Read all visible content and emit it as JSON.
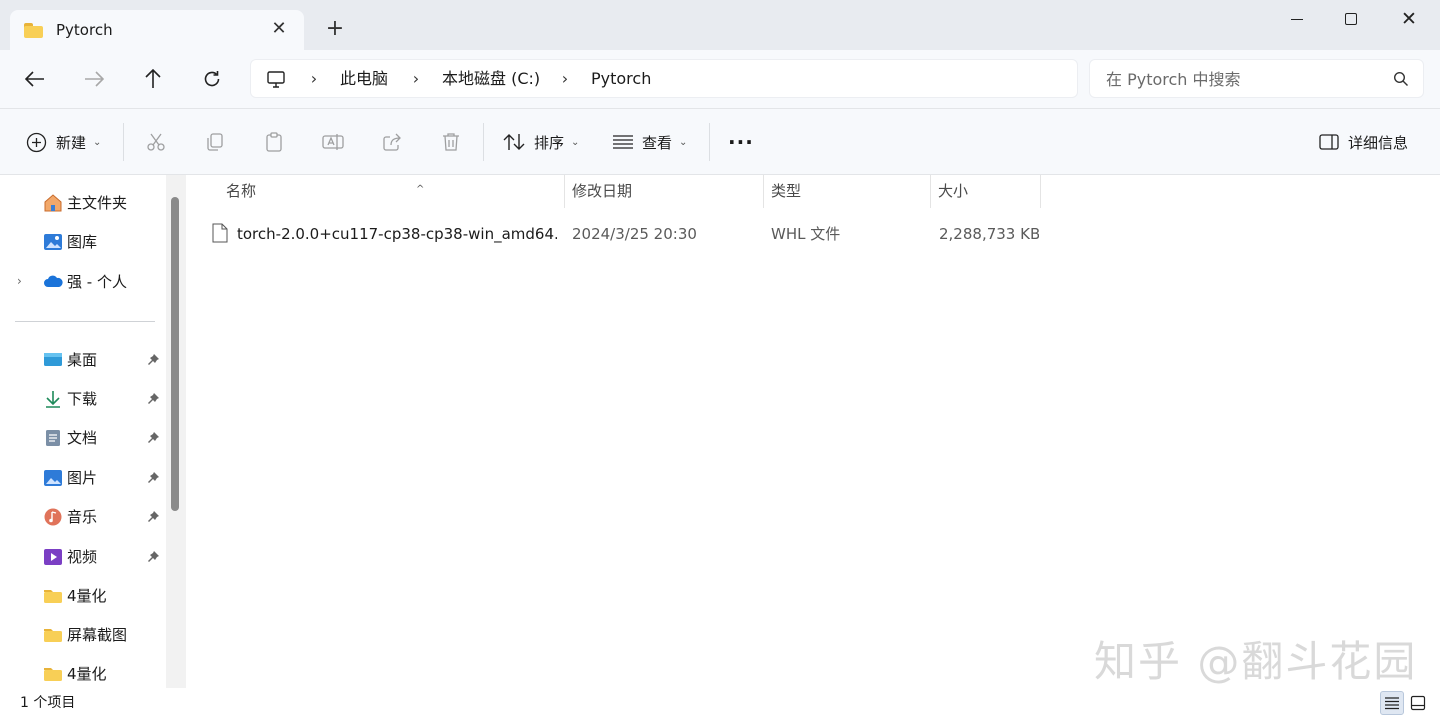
{
  "window": {
    "tab_title": "Pytorch",
    "tab_close": "✕",
    "new_tab": "+",
    "close_glyph": "✕"
  },
  "nav": {
    "breadcrumbs": [
      "此电脑",
      "本地磁盘 (C:)",
      "Pytorch"
    ],
    "separator": "›",
    "search_placeholder": "在 Pytorch 中搜索"
  },
  "toolbar": {
    "new_label": "新建",
    "sort_label": "排序",
    "view_label": "查看",
    "more_label": "···",
    "details_label": "详细信息",
    "dropdown_glyph": "⌄",
    "icons": [
      "cut-icon",
      "copy-icon",
      "paste-icon",
      "rename-icon",
      "share-icon",
      "delete-icon"
    ]
  },
  "sidebar": {
    "expander": "›",
    "items": [
      {
        "label": "主文件夹",
        "icon": "home-icon"
      },
      {
        "label": "图库",
        "icon": "gallery-icon"
      },
      {
        "label": "强 - 个人",
        "icon": "onedrive-icon"
      },
      {
        "label": "桌面",
        "icon": "desktop-icon",
        "pinned": true
      },
      {
        "label": "下载",
        "icon": "download-icon",
        "pinned": true
      },
      {
        "label": "文档",
        "icon": "documents-icon",
        "pinned": true
      },
      {
        "label": "图片",
        "icon": "pictures-icon",
        "pinned": true
      },
      {
        "label": "音乐",
        "icon": "music-icon",
        "pinned": true
      },
      {
        "label": "视频",
        "icon": "videos-icon",
        "pinned": true
      },
      {
        "label": "4量化",
        "icon": "folder-icon"
      },
      {
        "label": "屏幕截图",
        "icon": "folder-icon"
      },
      {
        "label": "4量化",
        "icon": "folder-icon"
      }
    ]
  },
  "columns": [
    "名称",
    "修改日期",
    "类型",
    "大小"
  ],
  "sort_indicator": "^",
  "files": [
    {
      "name": "torch-2.0.0+cu117-cp38-cp38-win_amd64....",
      "modified": "2024/3/25 20:30",
      "type": "WHL 文件",
      "size": "2,288,733 KB"
    }
  ],
  "status": {
    "item_count": "1 个项目"
  },
  "watermark": "知乎 @翻斗花园",
  "colors": {
    "accent": "#0067c0",
    "folder": "#f8cf56",
    "chrome": "#f7f9fc",
    "tabbar": "#e8ebf0"
  }
}
